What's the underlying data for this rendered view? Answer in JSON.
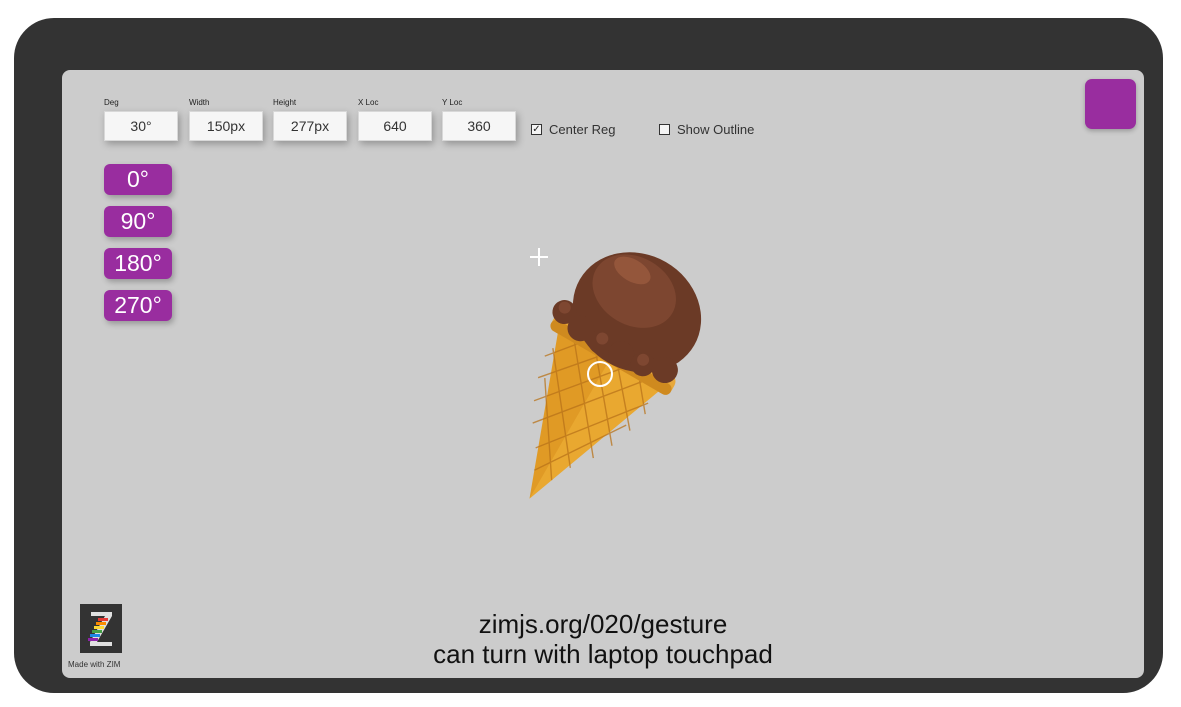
{
  "fields": [
    {
      "label": "Deg",
      "value": "30°"
    },
    {
      "label": "Width",
      "value": "150px"
    },
    {
      "label": "Height",
      "value": "277px"
    },
    {
      "label": "X Loc",
      "value": "640"
    },
    {
      "label": "Y Loc",
      "value": "360"
    }
  ],
  "checkboxes": {
    "center_reg": {
      "label": "Center Reg",
      "checked": true
    },
    "show_outline": {
      "label": "Show Outline",
      "checked": false
    }
  },
  "rotation_buttons": [
    "0°",
    "90°",
    "180°",
    "270°"
  ],
  "caption": {
    "line1": "zimjs.org/020/gesture",
    "line2": "can turn with laptop touchpad"
  },
  "logo": {
    "made_with": "Made with ZIM",
    "letter": "Z"
  },
  "colors": {
    "accent": "#992d9f",
    "stage": "#cccccc",
    "frame": "#333333"
  },
  "icons": {
    "registration": "plus-icon",
    "center": "circle-icon",
    "object": "ice-cream-cone-icon"
  }
}
